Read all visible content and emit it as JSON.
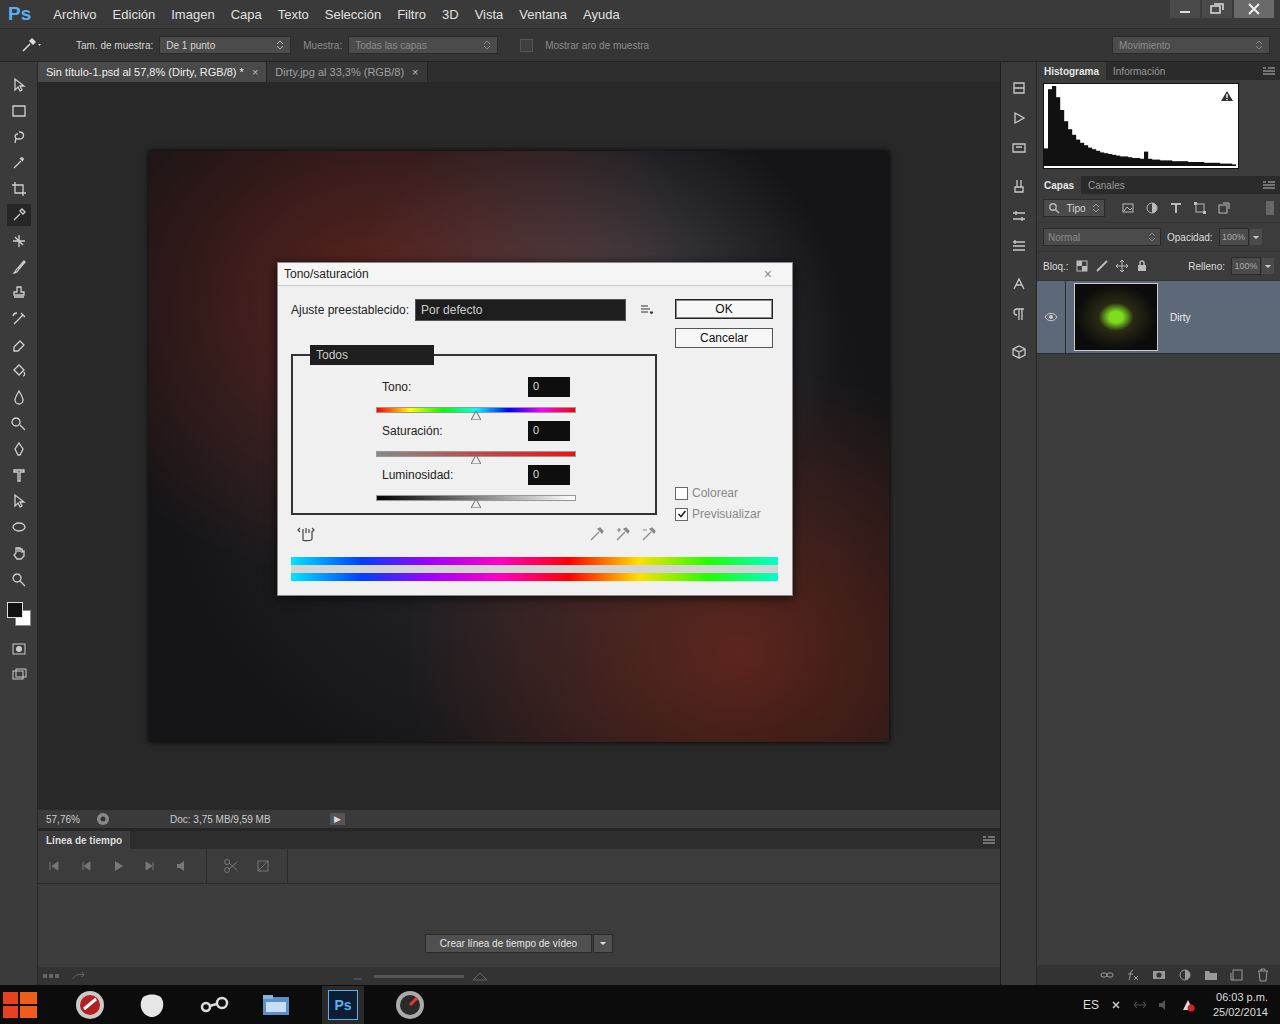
{
  "window": {
    "app_logo": "Ps"
  },
  "menu": [
    "Archivo",
    "Edición",
    "Imagen",
    "Capa",
    "Texto",
    "Selección",
    "Filtro",
    "3D",
    "Vista",
    "Ventana",
    "Ayuda"
  ],
  "options_bar": {
    "sample_size_label": "Tam. de muestra:",
    "sample_size": "De 1 punto",
    "sample_label": "Muestra:",
    "sample": "Todas las capas",
    "show_ring": {
      "label": "Mostrar aro de muestra",
      "checked": false
    },
    "workspace": "Movimiento"
  },
  "doc_tabs": [
    {
      "label": "Sin título-1.psd al 57,8% (Dirty, RGB/8) *",
      "selected": true,
      "close": "×"
    },
    {
      "label": "Dirty.jpg al 33,3% (RGB/8)",
      "selected": false,
      "close": "×"
    }
  ],
  "status_bar": {
    "zoom": "57,76%",
    "doc": "Doc: 3,75 MB/9,59 MB",
    "arrow": "▶"
  },
  "timeline": {
    "title": "Línea de tiempo",
    "button": "Crear línea de tiempo de vídeo"
  },
  "histogram_panel": {
    "tabs": [
      {
        "label": "Histograma",
        "selected": true
      },
      {
        "label": "Información",
        "selected": false
      }
    ],
    "values": [
      22,
      96,
      100,
      86,
      70,
      56,
      46,
      39,
      33,
      29,
      26,
      23,
      21,
      19,
      17,
      16,
      15,
      14,
      13,
      12,
      12,
      11,
      10,
      10,
      9,
      18,
      9,
      8,
      8,
      7,
      7,
      7,
      6,
      6,
      6,
      6,
      5,
      5,
      5,
      5,
      4,
      4,
      4,
      4,
      3,
      3,
      3,
      2
    ]
  },
  "layers_panel": {
    "tabs": [
      {
        "label": "Capas",
        "selected": true
      },
      {
        "label": "Canales",
        "selected": false
      }
    ],
    "filter": "Tipo",
    "blend_mode": "Normal",
    "opacity_label": "Opacidad:",
    "opacity": "100%",
    "lock_label": "Bloq.:",
    "fill_label": "Relleno:",
    "fill": "100%",
    "layers": [
      {
        "name": "Dirty",
        "visible": true,
        "selected": true
      }
    ]
  },
  "dialog": {
    "title": "Tono/saturación",
    "close": "×",
    "preset_label": "Ajuste preestablecido:",
    "preset": "Por defecto",
    "channel": "Todos",
    "sliders": [
      {
        "label": "Tono:",
        "value": "0",
        "level": 0.5,
        "kind": "hue"
      },
      {
        "label": "Saturación:",
        "value": "0",
        "level": 0.5,
        "kind": "saturation"
      },
      {
        "label": "Luminosidad:",
        "value": "0",
        "level": 0.5,
        "kind": "lightness"
      }
    ],
    "buttons": [
      {
        "label": "OK",
        "default": true
      },
      {
        "label": "Cancelar",
        "default": false
      }
    ],
    "checkboxes": [
      {
        "label": "Colorear",
        "checked": false
      },
      {
        "label": "Previsualizar",
        "checked": true
      }
    ]
  },
  "taskbar": {
    "ps_label": "Ps",
    "language": "ES",
    "time": "06:03 p.m.",
    "date": "25/02/2014"
  }
}
